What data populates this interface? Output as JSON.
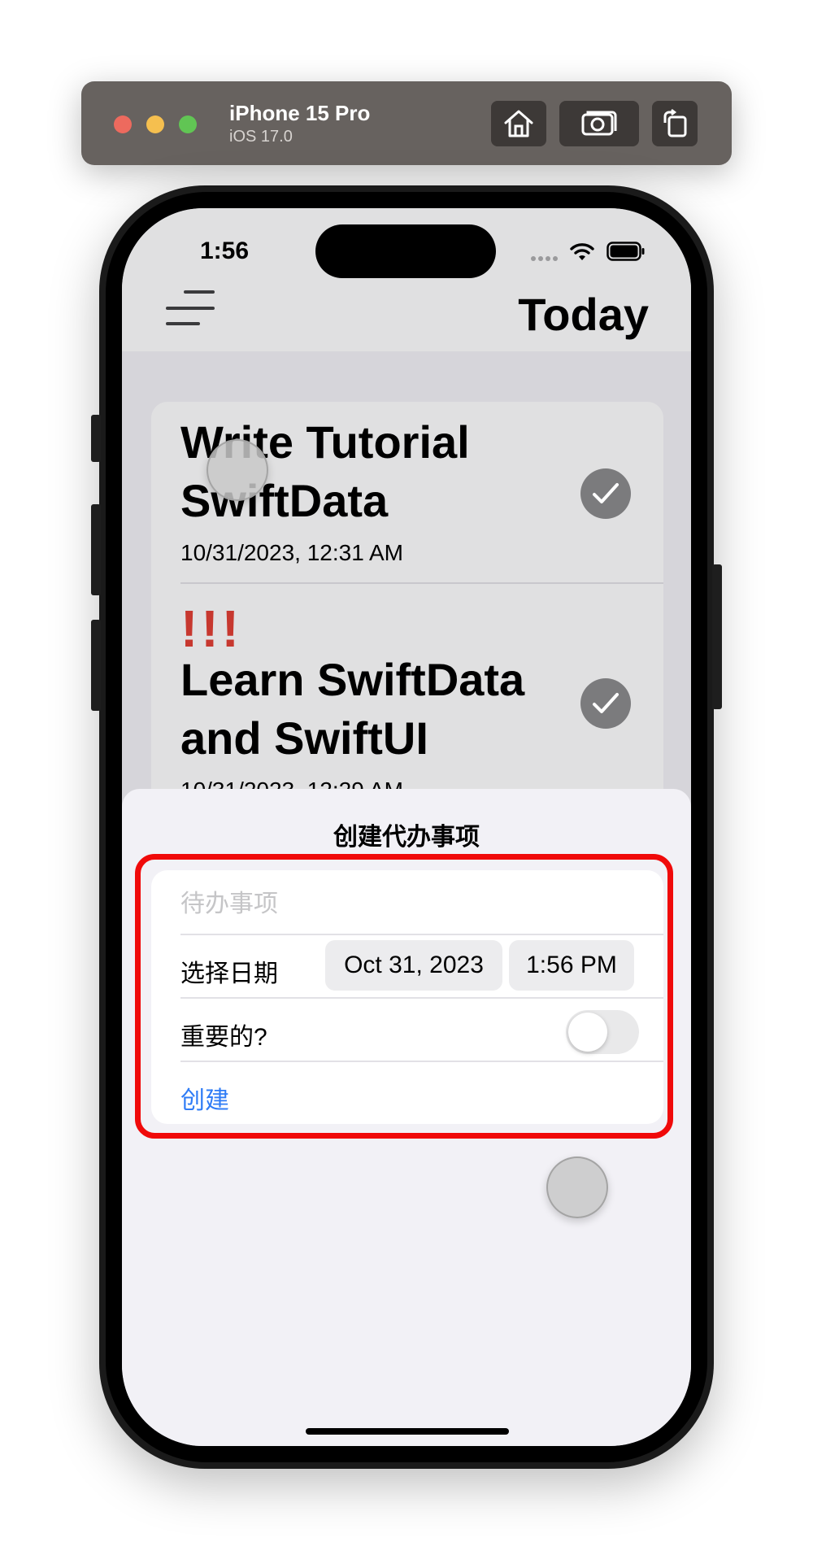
{
  "simulator": {
    "device_name": "iPhone 15 Pro",
    "os_version": "iOS 17.0",
    "buttons": {
      "home": "home-icon",
      "screenshot": "camera-icon",
      "rotate": "rotate-icon"
    }
  },
  "status_bar": {
    "time": "1:56"
  },
  "nav": {
    "title": "Today"
  },
  "todos": [
    {
      "title_line1": "Write Tutorial",
      "title_line2": "SwiftData",
      "date": "10/31/2023, 12:31 AM",
      "priority": ""
    },
    {
      "title_line1": "Learn SwiftData",
      "title_line2": "and SwiftUI",
      "date": "10/31/2023, 12:29 AM",
      "priority": "!!!"
    }
  ],
  "sheet": {
    "title": "创建代办事项",
    "title_placeholder": "待办事项",
    "date_label": "选择日期",
    "date_value": "Oct 31, 2023",
    "time_value": "1:56 PM",
    "important_label": "重要的?",
    "important_on": false,
    "create_label": "创建"
  },
  "colors": {
    "accent": "#2f7cf6",
    "highlight": "#f00a0a",
    "priority": "#c7382f"
  }
}
